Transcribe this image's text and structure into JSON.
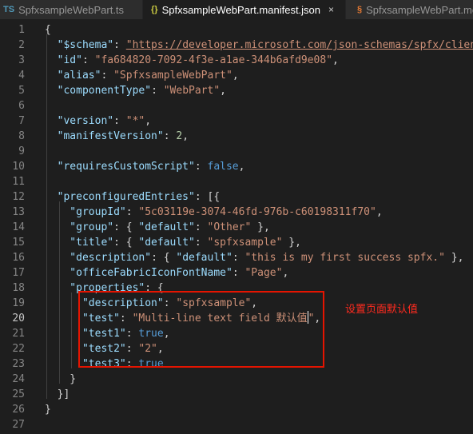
{
  "tabs": [
    {
      "icon": "TS",
      "label": "SpfxsampleWebPart.ts",
      "active": false
    },
    {
      "icon": "{}",
      "label": "SpfxsampleWebPart.manifest.json",
      "active": true,
      "close": "×"
    },
    {
      "icon": "§",
      "label": "SpfxsampleWebPart.mo",
      "active": false
    }
  ],
  "editor": {
    "current_line": 20,
    "annotation": "设置页面默认值",
    "lines": [
      {
        "n": "1",
        "segs": [
          {
            "c": "p",
            "t": "{"
          }
        ]
      },
      {
        "n": "2",
        "segs": [
          {
            "c": "k",
            "t": "  \"$schema\""
          },
          {
            "c": "p",
            "t": ": "
          },
          {
            "c": "u",
            "t": "\"https://developer.microsoft.com/json-schemas/spfx/client"
          }
        ]
      },
      {
        "n": "3",
        "segs": [
          {
            "c": "k",
            "t": "  \"id\""
          },
          {
            "c": "p",
            "t": ": "
          },
          {
            "c": "s",
            "t": "\"fa684820-7092-4f3e-a1ae-344b6afd9e08\""
          },
          {
            "c": "p",
            "t": ","
          }
        ]
      },
      {
        "n": "4",
        "segs": [
          {
            "c": "k",
            "t": "  \"alias\""
          },
          {
            "c": "p",
            "t": ": "
          },
          {
            "c": "s",
            "t": "\"SpfxsampleWebPart\""
          },
          {
            "c": "p",
            "t": ","
          }
        ]
      },
      {
        "n": "5",
        "segs": [
          {
            "c": "k",
            "t": "  \"componentType\""
          },
          {
            "c": "p",
            "t": ": "
          },
          {
            "c": "s",
            "t": "\"WebPart\""
          },
          {
            "c": "p",
            "t": ","
          }
        ]
      },
      {
        "n": "6",
        "segs": []
      },
      {
        "n": "7",
        "segs": [
          {
            "c": "k",
            "t": "  \"version\""
          },
          {
            "c": "p",
            "t": ": "
          },
          {
            "c": "s",
            "t": "\"*\""
          },
          {
            "c": "p",
            "t": ","
          }
        ]
      },
      {
        "n": "8",
        "segs": [
          {
            "c": "k",
            "t": "  \"manifestVersion\""
          },
          {
            "c": "p",
            "t": ": "
          },
          {
            "c": "n",
            "t": "2"
          },
          {
            "c": "p",
            "t": ","
          }
        ]
      },
      {
        "n": "9",
        "segs": []
      },
      {
        "n": "10",
        "segs": [
          {
            "c": "k",
            "t": "  \"requiresCustomScript\""
          },
          {
            "c": "p",
            "t": ": "
          },
          {
            "c": "b",
            "t": "false"
          },
          {
            "c": "p",
            "t": ","
          }
        ]
      },
      {
        "n": "11",
        "segs": []
      },
      {
        "n": "12",
        "segs": [
          {
            "c": "k",
            "t": "  \"preconfiguredEntries\""
          },
          {
            "c": "p",
            "t": ": [{"
          }
        ]
      },
      {
        "n": "13",
        "segs": [
          {
            "c": "k",
            "t": "    \"groupId\""
          },
          {
            "c": "p",
            "t": ": "
          },
          {
            "c": "s",
            "t": "\"5c03119e-3074-46fd-976b-c60198311f70\""
          },
          {
            "c": "p",
            "t": ","
          }
        ]
      },
      {
        "n": "14",
        "segs": [
          {
            "c": "k",
            "t": "    \"group\""
          },
          {
            "c": "p",
            "t": ": { "
          },
          {
            "c": "k",
            "t": "\"default\""
          },
          {
            "c": "p",
            "t": ": "
          },
          {
            "c": "s",
            "t": "\"Other\""
          },
          {
            "c": "p",
            "t": " },"
          }
        ]
      },
      {
        "n": "15",
        "segs": [
          {
            "c": "k",
            "t": "    \"title\""
          },
          {
            "c": "p",
            "t": ": { "
          },
          {
            "c": "k",
            "t": "\"default\""
          },
          {
            "c": "p",
            "t": ": "
          },
          {
            "c": "s",
            "t": "\"spfxsample\""
          },
          {
            "c": "p",
            "t": " },"
          }
        ]
      },
      {
        "n": "16",
        "segs": [
          {
            "c": "k",
            "t": "    \"description\""
          },
          {
            "c": "p",
            "t": ": { "
          },
          {
            "c": "k",
            "t": "\"default\""
          },
          {
            "c": "p",
            "t": ": "
          },
          {
            "c": "s",
            "t": "\"this is my first success spfx.\""
          },
          {
            "c": "p",
            "t": " },"
          }
        ]
      },
      {
        "n": "17",
        "segs": [
          {
            "c": "k",
            "t": "    \"officeFabricIconFontName\""
          },
          {
            "c": "p",
            "t": ": "
          },
          {
            "c": "s",
            "t": "\"Page\""
          },
          {
            "c": "p",
            "t": ","
          }
        ]
      },
      {
        "n": "18",
        "segs": [
          {
            "c": "k",
            "t": "    \"properties\""
          },
          {
            "c": "p",
            "t": ": {"
          }
        ]
      },
      {
        "n": "19",
        "segs": [
          {
            "c": "k",
            "t": "      \"description\""
          },
          {
            "c": "p",
            "t": ": "
          },
          {
            "c": "s",
            "t": "\"spfxsample\""
          },
          {
            "c": "p",
            "t": ","
          }
        ]
      },
      {
        "n": "20",
        "segs": [
          {
            "c": "k",
            "t": "      \"test\""
          },
          {
            "c": "p",
            "t": ": "
          },
          {
            "c": "s",
            "t": "\"Multi-line text field 默认值"
          },
          {
            "c": "caret",
            "t": ""
          },
          {
            "c": "s",
            "t": "\""
          },
          {
            "c": "p",
            "t": ","
          }
        ]
      },
      {
        "n": "21",
        "segs": [
          {
            "c": "k",
            "t": "      \"test1\""
          },
          {
            "c": "p",
            "t": ": "
          },
          {
            "c": "b",
            "t": "true"
          },
          {
            "c": "p",
            "t": ","
          }
        ]
      },
      {
        "n": "22",
        "segs": [
          {
            "c": "k",
            "t": "      \"test2\""
          },
          {
            "c": "p",
            "t": ": "
          },
          {
            "c": "s",
            "t": "\"2\""
          },
          {
            "c": "p",
            "t": ","
          }
        ]
      },
      {
        "n": "23",
        "segs": [
          {
            "c": "k",
            "t": "      \"test3\""
          },
          {
            "c": "p",
            "t": ": "
          },
          {
            "c": "b",
            "t": "true"
          }
        ]
      },
      {
        "n": "24",
        "segs": [
          {
            "c": "p",
            "t": "    }"
          }
        ]
      },
      {
        "n": "25",
        "segs": [
          {
            "c": "p",
            "t": "  }]"
          }
        ]
      },
      {
        "n": "26",
        "segs": [
          {
            "c": "p",
            "t": "}"
          }
        ]
      },
      {
        "n": "27",
        "segs": []
      }
    ]
  }
}
